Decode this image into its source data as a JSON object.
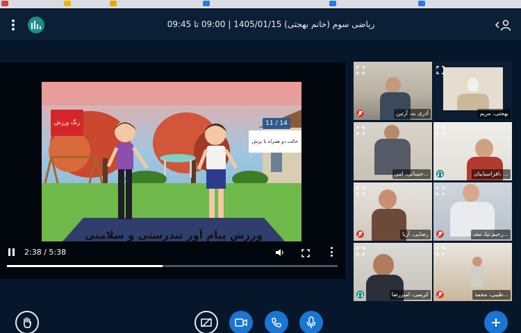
{
  "taskbar": {
    "items": [
      "",
      "",
      "",
      "",
      ""
    ]
  },
  "header": {
    "title": "ریاضی سوم (خانم بهجتی) 1405/01/15 | 09:00 تا 09:45"
  },
  "video": {
    "overlay_badge": "زنگ ورزش",
    "slide_counter": "11 / 14",
    "exercise_caption": "حالت دو همراه با پرش",
    "subtitle": "ورزش پیام آور تندرستی و سلامتی",
    "time_display": "2:38 / 5:38",
    "progress": 0.47
  },
  "participants": [
    {
      "name": "آذری به، آرتین",
      "mic": "off"
    },
    {
      "name": "بهجتی، مریم",
      "mic": "none"
    },
    {
      "name": "حبیبانی، امی...",
      "mic": "none"
    },
    {
      "name": "افراسیابیان، ...",
      "mic": "on"
    },
    {
      "name": "رضایی، آریا",
      "mic": "off"
    },
    {
      "name": "رحیم نیا، محـ...",
      "mic": "off"
    },
    {
      "name": "کریمی، امیررضا",
      "mic": "on"
    },
    {
      "name": "طیبی، محمد...",
      "mic": "off"
    }
  ],
  "colors": {
    "background": "#06172b",
    "header": "#0b1f36",
    "accent_blue": "#1976d2",
    "mic_muted": "#e53935",
    "mic_active": "#0a8a7e",
    "logo": "#1a8f88"
  },
  "icons": {
    "raise_hand": "hand-icon",
    "screen_share_off": "screen-share-off-icon",
    "camera": "video-camera-icon",
    "phone": "phone-icon",
    "microphone": "microphone-icon",
    "add": "plus-icon"
  }
}
